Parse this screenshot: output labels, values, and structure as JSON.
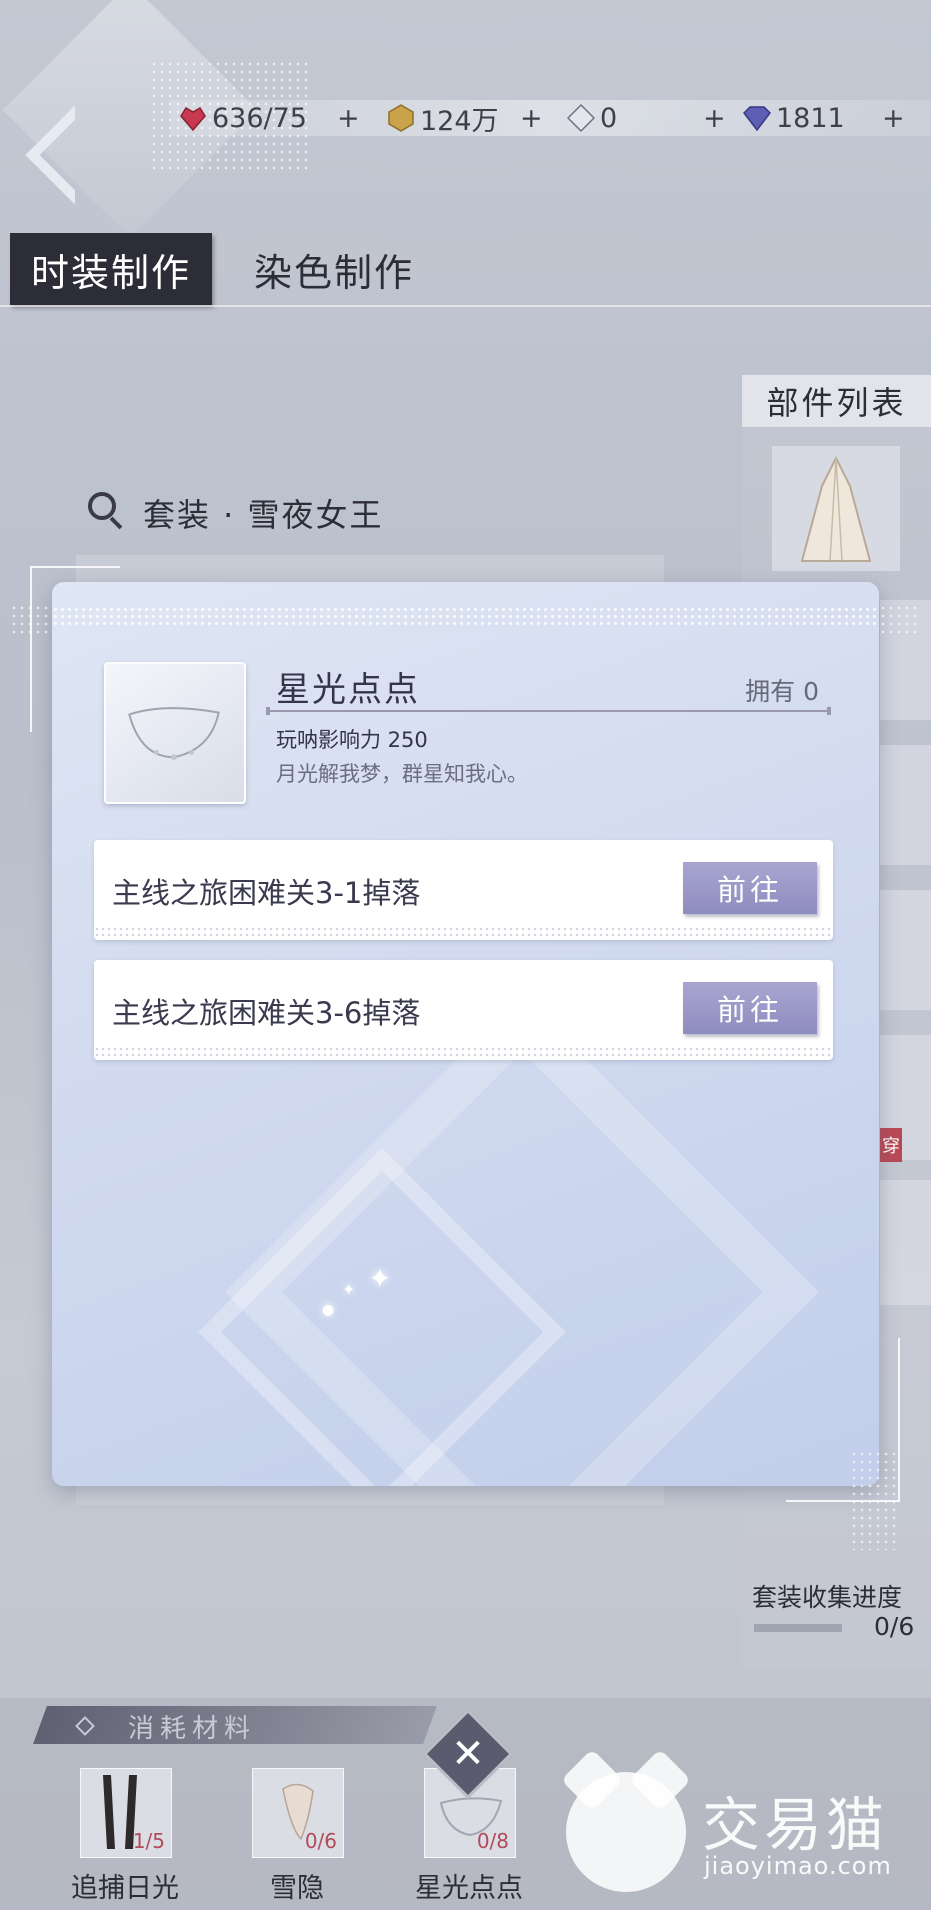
{
  "resources": [
    {
      "icon": "ruby-heart-icon",
      "value": "636/75"
    },
    {
      "icon": "gold-coin-icon",
      "value": "124万"
    },
    {
      "icon": "crystal-icon",
      "value": "0"
    },
    {
      "icon": "diamond-icon",
      "value": "1811"
    }
  ],
  "tabs": {
    "active": "时装制作",
    "other": "染色制作"
  },
  "right_panel": {
    "title": "部件列表",
    "tag": "穿",
    "progress_label": "套装收集进度",
    "progress_value": "0/6"
  },
  "search": {
    "label": "套装 · 雪夜女王"
  },
  "modal": {
    "item_name": "星光点点",
    "own": "拥有 0",
    "stat": "玩呐影响力 250",
    "description": "月光解我梦，群星知我心。",
    "sources": [
      {
        "text": "主线之旅困难关3-1掉落",
        "button": "前往"
      },
      {
        "text": "主线之旅困难关3-6掉落",
        "button": "前往"
      }
    ]
  },
  "materials": {
    "label": "消耗材料",
    "items": [
      {
        "name": "追捕日光",
        "count": "1/5"
      },
      {
        "name": "雪隐",
        "count": "0/6"
      },
      {
        "name": "星光点点",
        "count": "0/8"
      }
    ]
  },
  "watermark": {
    "brand": "交易猫",
    "url": "jiaoyimao.com"
  },
  "colors": {
    "accent_button": "#9c9ac8",
    "tab_dark": "#2c2d37",
    "count_red": "#b24b5a"
  }
}
